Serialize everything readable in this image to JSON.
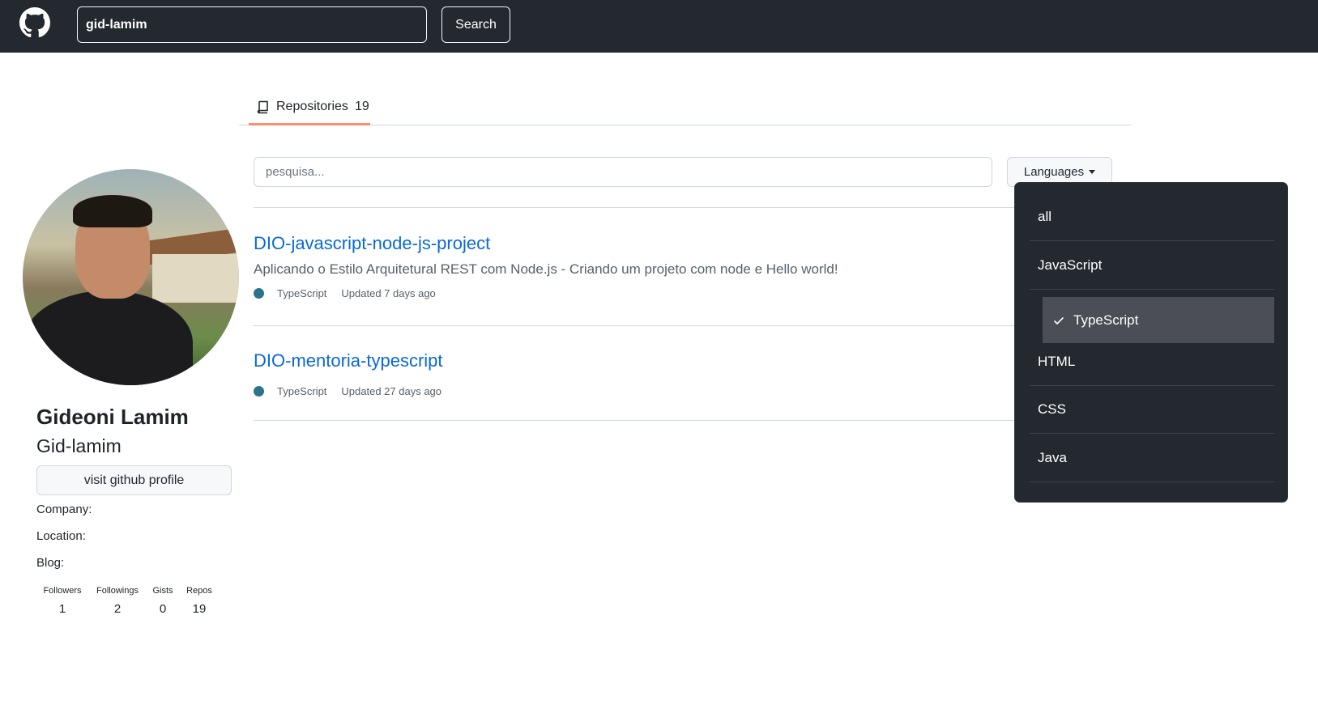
{
  "header": {
    "search_value": "gid-lamim",
    "search_button": "Search"
  },
  "tabs": {
    "repositories_label": "Repositories",
    "repositories_count": "19"
  },
  "profile": {
    "name": "Gideoni Lamim",
    "login": "Gid-lamim",
    "visit_button": "visit github profile",
    "company_label": "Company:",
    "location_label": "Location:",
    "blog_label": "Blog:",
    "stats": [
      {
        "label": "Followers",
        "value": "1"
      },
      {
        "label": "Followings",
        "value": "2"
      },
      {
        "label": "Gists",
        "value": "0"
      },
      {
        "label": "Repos",
        "value": "19"
      }
    ]
  },
  "filter": {
    "search_placeholder": "pesquisa...",
    "languages_button": "Languages"
  },
  "repos": [
    {
      "name": "DIO-javascript-node-js-project",
      "description": "Aplicando o Estilo Arquitetural REST com Node.js - Criando um projeto com node e Hello world!",
      "language": "TypeScript",
      "updated": "Updated 7 days ago"
    },
    {
      "name": "DIO-mentoria-typescript",
      "description": "",
      "language": "TypeScript",
      "updated": "Updated 27 days ago"
    }
  ],
  "dropdown": {
    "options": [
      "all",
      "JavaScript",
      "TypeScript",
      "HTML",
      "CSS",
      "Java"
    ],
    "selected": "TypeScript"
  },
  "colors": {
    "header_bg": "#24292f",
    "link": "#0969da",
    "tab_underline": "#fd8c73",
    "language_dot": "#2b7489",
    "dropdown_bg": "#24292f",
    "dropdown_selected_bg": "#4b4e55"
  },
  "icons": {
    "logo": "github-mark-icon",
    "tab": "repo-book-icon",
    "caret": "caret-down-icon",
    "check": "check-icon"
  }
}
